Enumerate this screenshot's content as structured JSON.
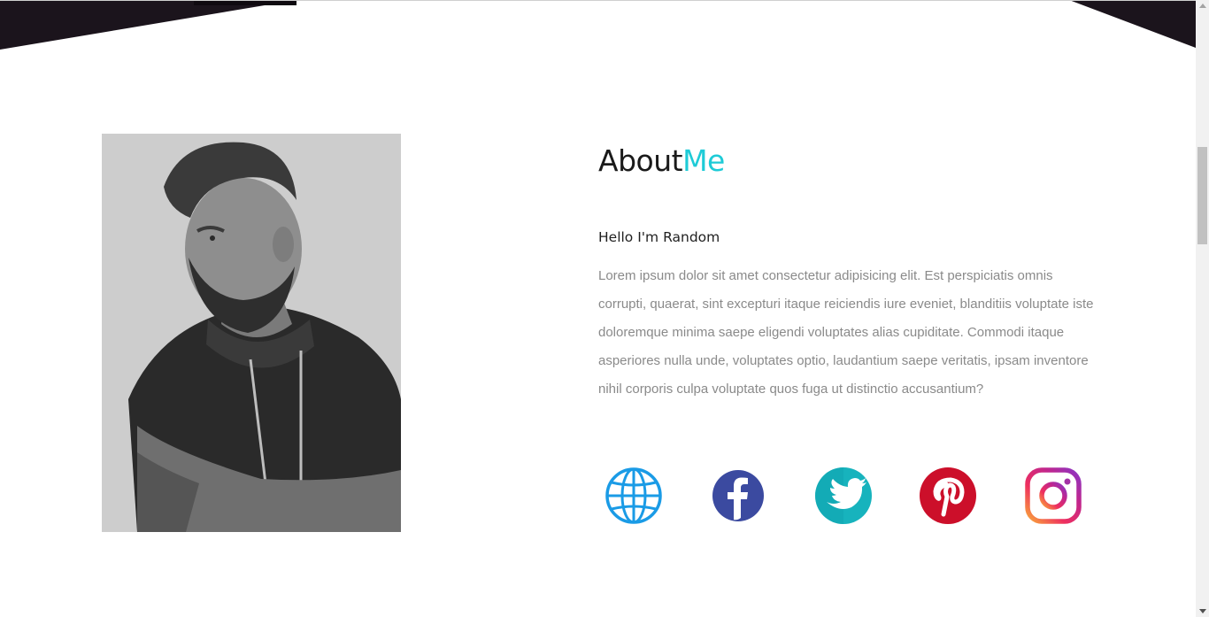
{
  "colors": {
    "dark_band": "#1b141c",
    "accent": "#1ecbd7",
    "text_dark": "#1a1a1a",
    "text_muted": "#8a8a8a"
  },
  "about": {
    "title_main": "About",
    "title_accent": "Me",
    "greeting": "Hello I'm Random",
    "bio": "Lorem ipsum dolor sit amet consectetur adipisicing elit. Est perspiciatis omnis corrupti, quaerat, sint excepturi itaque reiciendis iure eveniet, blanditiis voluptate iste doloremque minima saepe eligendi voluptates alias cupiditate. Commodi itaque asperiores nulla unde, voluptates optio, laudantium saepe veritatis, ipsam inventore nihil corporis culpa voluptate quos fuga ut distinctio accusantium?"
  },
  "portrait": {
    "description_icon": "person-photo"
  },
  "social_links": [
    {
      "icon": "globe-icon",
      "color": "#1a9be6"
    },
    {
      "icon": "facebook-icon",
      "color": "#3b4aa0"
    },
    {
      "icon": "twitter-icon",
      "color": "#1aa8b8"
    },
    {
      "icon": "pinterest-icon",
      "color": "#cc0f2a"
    },
    {
      "icon": "instagram-icon",
      "color": "#c0268e"
    }
  ]
}
